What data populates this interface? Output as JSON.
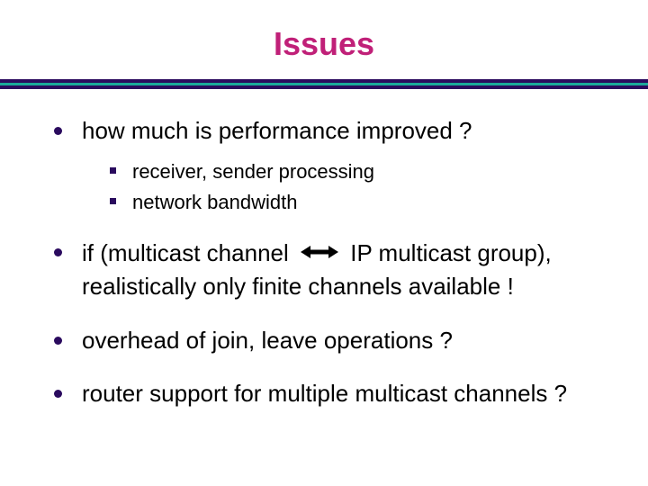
{
  "title": "Issues",
  "bullets": {
    "b1": {
      "text": "how much is performance improved ?",
      "sub": {
        "s1": "receiver, sender processing",
        "s2": "network bandwidth"
      }
    },
    "b2": {
      "pre": "if (multicast channel",
      "post": "IP multicast group), realistically only finite channels available !"
    },
    "b3": {
      "text": "overhead of join, leave operations ?"
    },
    "b4": {
      "text": "router support for multiple multicast channels ?"
    }
  }
}
